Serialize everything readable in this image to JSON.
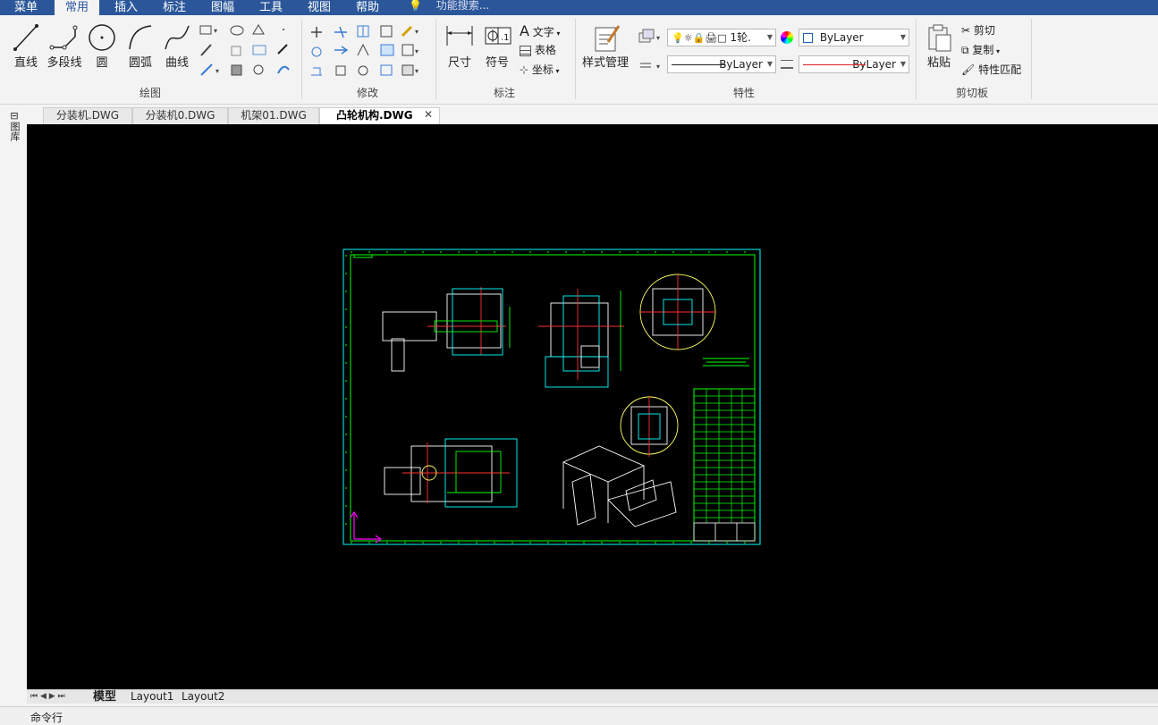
{
  "menu": {
    "items": [
      "菜单",
      "常用",
      "插入",
      "标注",
      "图幅",
      "工具",
      "视图",
      "帮助"
    ],
    "search_placeholder": "功能搜索..."
  },
  "ribbon": {
    "draw": {
      "line": "直线",
      "polyline": "多段线",
      "circle": "圆",
      "arc": "圆弧",
      "curve": "曲线",
      "group": "绘图"
    },
    "modify": {
      "group": "修改"
    },
    "annotate": {
      "dimension": "尺寸",
      "symbol": "符号",
      "text": "文字",
      "table": "表格",
      "coord": "坐标",
      "group": "标注"
    },
    "properties": {
      "style_manager": "样式管理",
      "layer_name": "1轮.",
      "color": "ByLayer",
      "linetype": "ByLayer",
      "lineweight": "ByLayer",
      "group": "特性"
    },
    "clipboard": {
      "paste": "粘贴",
      "cut": "剪切",
      "copy": "复制",
      "match": "特性匹配",
      "group": "剪切板"
    }
  },
  "doc_tabs": [
    "分装机.DWG",
    "分装机0.DWG",
    "机架01.DWG",
    "凸轮机构.DWG"
  ],
  "sidebar": {
    "label": "图库"
  },
  "layout_tabs": [
    "模型",
    "Layout1",
    "Layout2"
  ],
  "command": {
    "label": "命令行"
  },
  "colors": {
    "menubar": "#2b579a",
    "canvas": "#000000",
    "frame": "#00ff00",
    "cyan": "#00ffff",
    "red": "#ff0000"
  }
}
